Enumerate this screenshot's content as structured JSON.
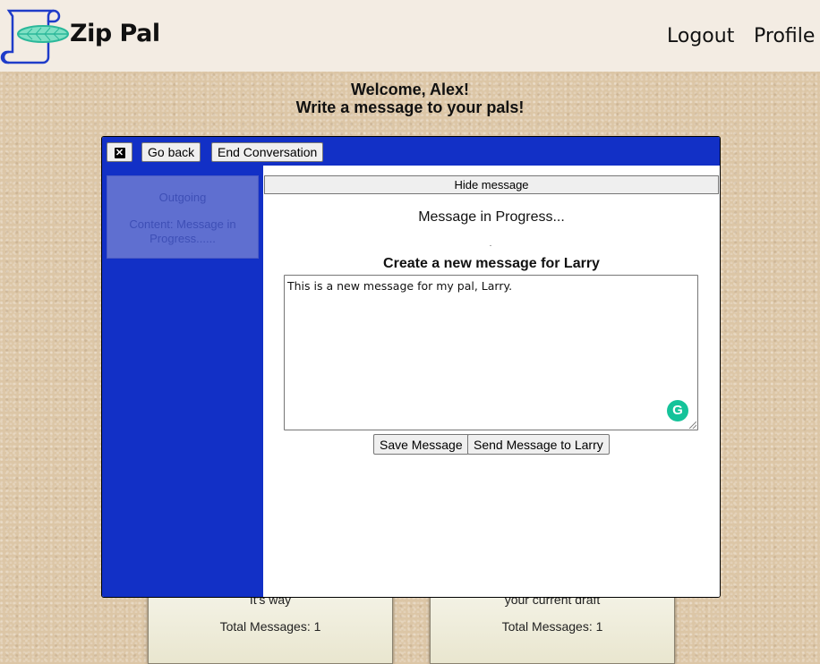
{
  "header": {
    "brand": "Zip Pal",
    "nav": {
      "logout": "Logout",
      "profile": "Profile"
    }
  },
  "welcome": {
    "line1": "Welcome, Alex!",
    "line2": "Write a message to your pals!"
  },
  "modal": {
    "toolbar": {
      "go_back": "Go back",
      "end_conversation": "End Conversation"
    },
    "conversation": {
      "direction": "Outgoing",
      "content": "Content: Message in Progress......"
    },
    "hide_message": "Hide message",
    "status": "Message in Progress...",
    "create_title": "Create a new message for Larry",
    "message_text": "This is a new message for my pal, Larry.",
    "save_label": "Save Message",
    "send_label": "Send Message to Larry"
  },
  "cards": [
    {
      "snippet": "It's way",
      "total": "Total Messages: 1"
    },
    {
      "snippet": "your current draft",
      "total": "Total Messages: 1"
    }
  ],
  "colors": {
    "accent": "#1230c6",
    "background": "#dcc6a6",
    "header": "#f3ece3",
    "grammarly": "#15c39a"
  }
}
